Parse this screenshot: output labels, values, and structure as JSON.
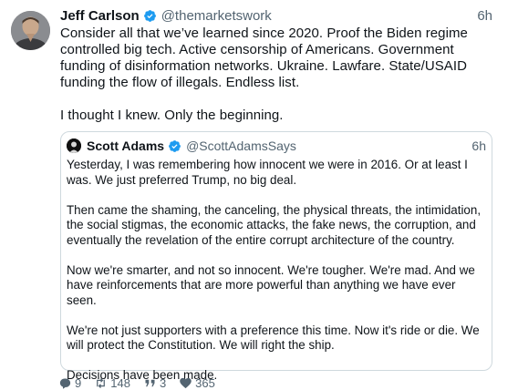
{
  "post": {
    "author_name": "Jeff Carlson",
    "author_handle": "@themarketswork",
    "timestamp": "6h",
    "paragraphs": [
      "Consider all that we’ve learned since 2020. Proof the Biden regime controlled big tech. Active censorship of Americans. Government funding of disinformation networks. Ukraine. Lawfare. State/USAID funding the flow of illegals. Endless list.",
      "I thought I knew. Only the beginning."
    ],
    "avatar_icon": "avatar-photo",
    "verified_icon": "verified-badge-icon"
  },
  "quoted_post": {
    "author_name": "Scott Adams",
    "author_handle": "@ScottAdamsSays",
    "timestamp": "6h",
    "paragraphs": [
      "Yesterday, I was remembering how innocent we were in 2016. Or at least I was. We just preferred Trump, no big deal.",
      "Then came the shaming, the canceling, the physical threats, the intimidation, the social stigmas, the economic attacks, the fake news, the corruption, and eventually the revelation of the entire corrupt architecture of the country.",
      "Now we're smarter, and not so innocent. We're tougher. We're mad. And we have reinforcements that are more powerful than anything we have ever seen.",
      "We're not just supporters with a preference this time. Now it's ride or die. We will protect the Constitution. We will right the ship.",
      "Decisions have been made."
    ]
  },
  "actions": {
    "replies": "9",
    "reposts": "148",
    "quotes": "3",
    "likes": "365"
  },
  "colors": {
    "verified": "#1d9bf0",
    "secondary_text": "#536471",
    "border": "#cfd9de"
  }
}
